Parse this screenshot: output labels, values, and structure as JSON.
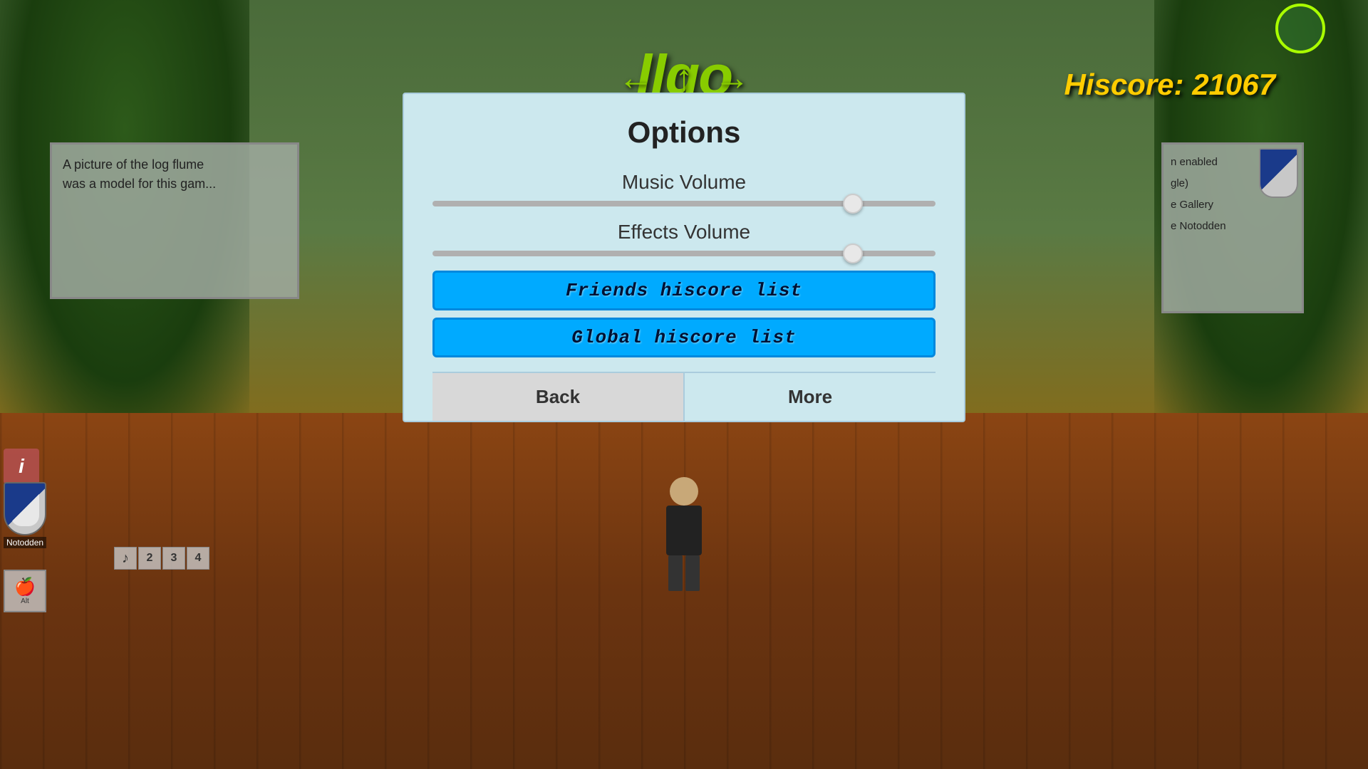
{
  "game": {
    "title": "llgo",
    "hiscore_label": "Hiscore: 21067",
    "circle_display": "●"
  },
  "scene": {
    "sign_left_text": "A picture of the log flume\nwas a model for this gam...",
    "sign_right_lines": [
      "n enabled",
      "gle)",
      "e Gallery",
      "e Notodden"
    ]
  },
  "arrows": {
    "left": "←",
    "up": "↑",
    "right": "→"
  },
  "notodden": {
    "label": "Notodden"
  },
  "options": {
    "title": "Options",
    "music_volume_label": "Music Volume",
    "music_volume_value": 85,
    "effects_volume_label": "Effects Volume",
    "effects_volume_value": 85,
    "friends_hiscore_label": "Friends hiscore list",
    "global_hiscore_label": "Global hiscore list",
    "back_button": "Back",
    "more_button": "More"
  },
  "score_bar": {
    "music_note": "♪",
    "cells": [
      "2",
      "3",
      "4"
    ]
  }
}
